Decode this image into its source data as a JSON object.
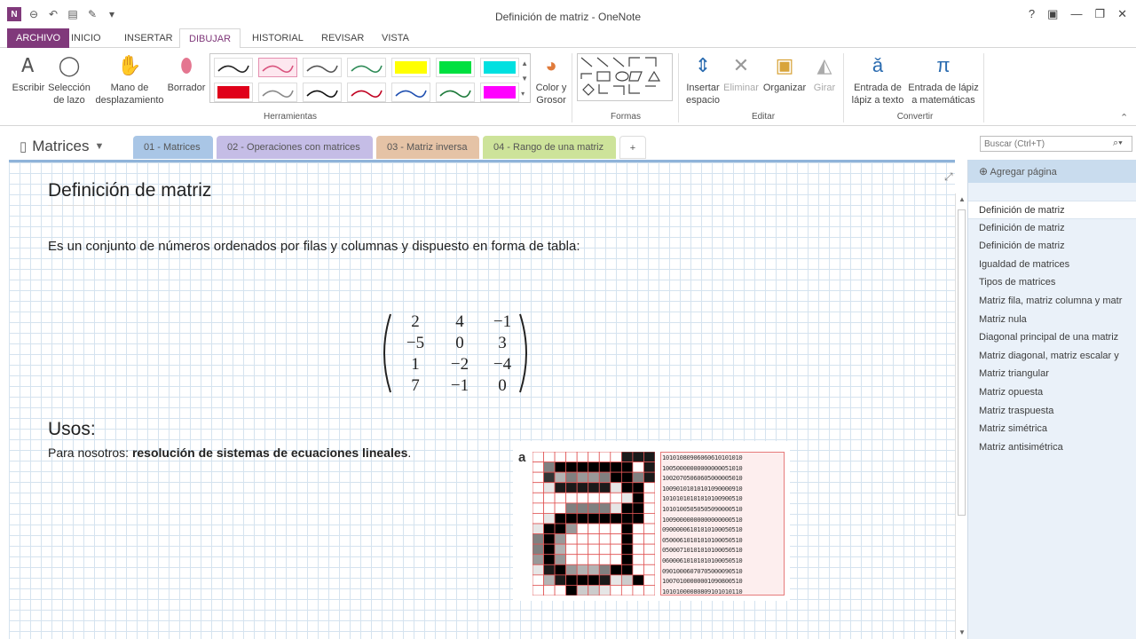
{
  "window": {
    "title": "Definición de matriz - OneNote",
    "controls": [
      "?",
      "▣",
      "—",
      "❐",
      "✕"
    ]
  },
  "tabs": [
    {
      "label": "ARCHIVO"
    },
    {
      "label": "INICIO"
    },
    {
      "label": "INSERTAR"
    },
    {
      "label": "DIBUJAR"
    },
    {
      "label": "HISTORIAL"
    },
    {
      "label": "REVISAR"
    },
    {
      "label": "VISTA"
    }
  ],
  "ribbon": {
    "tools": {
      "escribir": "Escribir",
      "seleccion": "Selección de lazo",
      "mano": "Mano de desplazamiento",
      "borrador": "Borrador"
    },
    "color_grosor": "Color y Grosor",
    "insertar_espacio": "Insertar espacio",
    "eliminar": "Eliminar",
    "organizar": "Organizar",
    "girar": "Girar",
    "entrada_texto": "Entrada de lápiz a texto",
    "entrada_math": "Entrada de lápiz a matemáticas",
    "groups": {
      "herramientas": "Herramientas",
      "formas": "Formas",
      "editar": "Editar",
      "convertir": "Convertir"
    },
    "pens": [
      "#222222",
      "#d9537e",
      "#555555",
      "#2e8b57",
      "#ffff00",
      "#00e040",
      "#00e0e0",
      "#e0001a",
      "#888888",
      "#111111",
      "#c00020",
      "#1f4fb0",
      "#1d7a3a",
      "#ff00ff"
    ]
  },
  "notebook": {
    "name": "Matrices"
  },
  "sections": [
    {
      "label": "01 - Matrices",
      "color": "#a9c6e6"
    },
    {
      "label": "02 - Operaciones con matrices",
      "color": "#c5bde6"
    },
    {
      "label": "03 - Matriz inversa",
      "color": "#e5c3a6"
    },
    {
      "label": "04 - Rango de una matriz",
      "color": "#cde39a"
    },
    {
      "label": "+",
      "color": "#ffffff"
    }
  ],
  "search": {
    "placeholder": "Buscar (Ctrl+T)"
  },
  "pages": {
    "add_label": "Agregar página",
    "items": [
      "Definición de matriz",
      "Definición de matriz",
      "Definición de matriz",
      "Igualdad de matrices",
      "Tipos de matrices",
      "Matriz fila, matriz columna y matr",
      "Matriz nula",
      "Diagonal principal de una matriz",
      "Matriz diagonal, matriz escalar y",
      "Matriz triangular",
      "Matriz opuesta",
      "Matriz traspuesta",
      "Matriz simétrica",
      "Matriz antisimétrica"
    ]
  },
  "page": {
    "title": "Definición de matriz",
    "description": "Es un conjunto de números ordenados por filas y columnas y dispuesto en forma de tabla:",
    "matrix": [
      [
        "2",
        "4",
        "−1"
      ],
      [
        "−5",
        "0",
        "3"
      ],
      [
        "1",
        "−2",
        "−4"
      ],
      [
        "7",
        "−1",
        "0"
      ]
    ],
    "usos_heading": "Usos:",
    "usos_prefix": "Para nosotros: ",
    "usos_bold": "resolución de sistemas de ecuaciones lineales",
    "usos_suffix": ".",
    "image_letter": "a",
    "image_numbers": [
      "10101080906060610101010",
      "10050000000000000051010",
      "10020705060605000005010",
      "10090101010101090000910",
      "10101010101010100900510",
      "10101005050505090000510",
      "10090000000000000000510",
      "09000006101010100050510",
      "05000610101010100050510",
      "05000710101010100050510",
      "06000610101010100050510",
      "09010006070705000090510",
      "10070100000001090800510",
      "10101000080809101010110"
    ]
  }
}
